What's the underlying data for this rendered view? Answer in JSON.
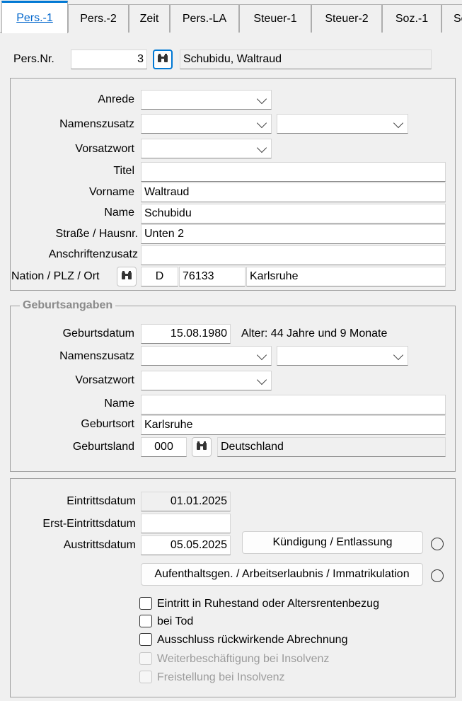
{
  "tabs": [
    {
      "label": "Pers.-1",
      "active": true
    },
    {
      "label": "Pers.-2"
    },
    {
      "label": "Zeit"
    },
    {
      "label": "Pers.-LA"
    },
    {
      "label": "Steuer-1"
    },
    {
      "label": "Steuer-2"
    },
    {
      "label": "Soz.-1"
    },
    {
      "label": "Soz"
    }
  ],
  "header": {
    "persnr_label": "Pers.Nr.",
    "persnr_value": "3",
    "persnr_name": "Schubidu, Waltraud",
    "lookup_icon": "binoculars-icon"
  },
  "person": {
    "anrede_label": "Anrede",
    "anrede_value": "",
    "namenszusatz_label": "Namenszusatz",
    "namenszusatz_value": "",
    "namenszusatz2_value": "",
    "vorsatzwort_label": "Vorsatzwort",
    "vorsatzwort_value": "",
    "titel_label": "Titel",
    "titel_value": "",
    "vorname_label": "Vorname",
    "vorname_value": "Waltraud",
    "name_label": "Name",
    "name_value": "Schubidu",
    "strasse_label": "Straße / Hausnr.",
    "strasse_value": "Unten 2",
    "anschriftenzusatz_label": "Anschriftenzusatz",
    "anschriftenzusatz_value": "",
    "nation_label": "Nation / PLZ / Ort",
    "nation_value": "D",
    "plz_value": "76133",
    "ort_value": "Karlsruhe"
  },
  "geburt": {
    "legend": "Geburtsangaben",
    "geburtsdatum_label": "Geburtsdatum",
    "geburtsdatum_value": "15.08.1980",
    "alter_text": "Alter: 44 Jahre und 9 Monate",
    "namenszusatz_label": "Namenszusatz",
    "namenszusatz_value": "",
    "namenszusatz2_value": "",
    "vorsatzwort_label": "Vorsatzwort",
    "vorsatzwort_value": "",
    "name_label": "Name",
    "name_value": "",
    "geburtsort_label": "Geburtsort",
    "geburtsort_value": "Karlsruhe",
    "geburtsland_label": "Geburtsland",
    "geburtsland_code": "000",
    "geburtsland_name": "Deutschland"
  },
  "beschaeftigung": {
    "eintritt_label": "Eintrittsdatum",
    "eintritt_value": "01.01.2025",
    "ersteintritt_label": "Erst-Eintrittsdatum",
    "ersteintritt_value": "",
    "austritt_label": "Austrittsdatum",
    "austritt_value": "05.05.2025",
    "kuendigung_button": "Kündigung / Entlassung",
    "aufenthalt_button": "Aufenthaltsgen. / Arbeitserlaubnis / Immatrikulation",
    "checkboxes": [
      {
        "label": "Eintritt in Ruhestand oder Altersrentenbezug",
        "checked": false,
        "enabled": true
      },
      {
        "label": "bei Tod",
        "checked": false,
        "enabled": true
      },
      {
        "label": "Ausschluss rückwirkende Abrechnung",
        "checked": false,
        "enabled": true
      },
      {
        "label": "Weiterbeschäftigung bei Insolvenz",
        "checked": false,
        "enabled": false
      },
      {
        "label": "Freistellung bei Insolvenz",
        "checked": false,
        "enabled": false
      }
    ]
  },
  "colors": {
    "accent": "#0078d4",
    "active_tab_text": "#0066cc",
    "disabled_text": "#9b9b9b"
  }
}
